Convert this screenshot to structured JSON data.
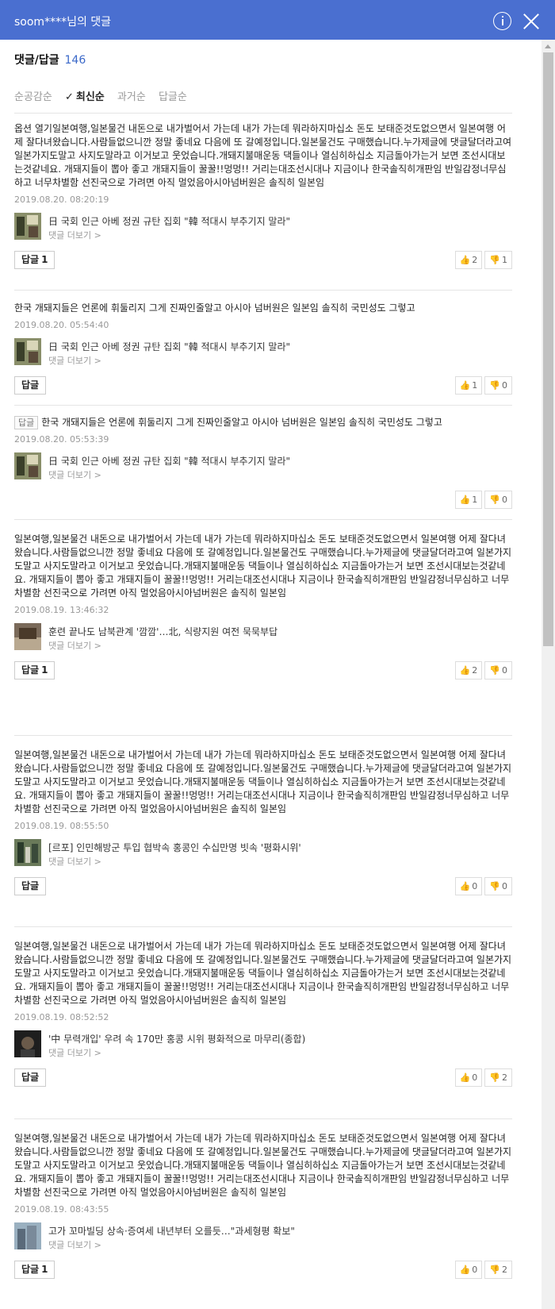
{
  "window": {
    "title": "soom****님의 댓글"
  },
  "header": {
    "label": "댓글/답글",
    "count": "146"
  },
  "sort": {
    "tabs": [
      {
        "label": "순공감순",
        "active": false
      },
      {
        "label": "최신순",
        "active": true
      },
      {
        "label": "과거순",
        "active": false
      },
      {
        "label": "답글순",
        "active": false
      }
    ]
  },
  "comments": [
    {
      "is_reply": false,
      "reply_tag": "",
      "text": "옵션 열기일본여행,일본물건 내돈으로 내가벌어서 가는데 내가 가는데 뭐라하지마십소 돈도 보태준것도없으면서 일본여행 어제 잘다녀왔습니다.사람들없으니깐 정말 좋네요 다음에 또 갈예정입니다.일본물건도 구매했습니다.누가제글에 댓글달더라고여 일본가지도말고 사지도말라고 이거보고 웃었습니다.개돼지불매운동 댁들이나 열심히하십소 지금돌아가는거 보면 조선시대보는것같네요. 개돼지들이 뽑아 좋고 개돼지들이 꿀꿀!!멍멍!! 거리는대조선시대나 지금이나 한국솔직히개판임 반일감정너무심하고 너무차별함 선진국으로 가려면 아직 멀었음아시아넘버원은 솔직히 일본임",
      "date": "2019.08.20. 08:20:19",
      "article_title": "日 국회 인근 아베 정권 규탄 집회 \"韓 적대시 부추기지 말라\"",
      "more": "댓글 더보기 >",
      "reply_label": "답글",
      "reply_count": "1",
      "likes": "2",
      "dislikes": "1"
    },
    {
      "is_reply": false,
      "reply_tag": "",
      "text": "한국 개돼지들은 언론에 휘둘리지 그게 진짜인줄알고 아시아 넘버원은 일본임 솔직히 국민성도 그렇고",
      "date": "2019.08.20. 05:54:40",
      "article_title": "日 국회 인근 아베 정권 규탄 집회 \"韓 적대시 부추기지 말라\"",
      "more": "댓글 더보기 >",
      "reply_label": "답글",
      "reply_count": "",
      "likes": "1",
      "dislikes": "0"
    },
    {
      "is_reply": true,
      "reply_tag": "답글",
      "text": "한국 개돼지들은 언론에 휘둘리지 그게 진짜인줄알고 아시아 넘버원은 일본임 솔직히 국민성도 그렇고",
      "date": "2019.08.20. 05:53:39",
      "article_title": "日 국회 인근 아베 정권 규탄 집회 \"韓 적대시 부추기지 말라\"",
      "more": "댓글 더보기 >",
      "reply_label": "",
      "reply_count": "",
      "likes": "1",
      "dislikes": "0"
    },
    {
      "is_reply": false,
      "reply_tag": "",
      "text": "일본여행,일본물건 내돈으로 내가벌어서 가는데 내가 가는데 뭐라하지마십소 돈도 보태준것도없으면서 일본여행 어제 잘다녀왔습니다.사람들없으니깐 정말 좋네요 다음에 또 갈예정입니다.일본물건도 구매했습니다.누가제글에 댓글달더라고여 일본가지도말고 사지도말라고 이거보고 웃었습니다.개돼지불매운동 댁들이나 열심히하십소 지금돌아가는거 보면 조선시대보는것같네요. 개돼지들이 뽑아 좋고 개돼지들이 꿀꿀!!멍멍!! 거리는대조선시대나 지금이나 한국솔직히개판임 반일감정너무심하고 너무차별함 선진국으로 가려면 아직 멀었음아시아넘버원은 솔직히 일본임",
      "date": "2019.08.19. 13:46:32",
      "article_title": "훈련 끝나도 남북관계 '깜깜'…北, 식량지원 여전 묵묵부답",
      "more": "댓글 더보기 >",
      "reply_label": "답글",
      "reply_count": "1",
      "likes": "2",
      "dislikes": "0"
    },
    {
      "is_reply": false,
      "reply_tag": "",
      "text": "일본여행,일본물건 내돈으로 내가벌어서 가는데 내가 가는데 뭐라하지마십소 돈도 보태준것도없으면서 일본여행 어제 잘다녀왔습니다.사람들없으니깐 정말 좋네요 다음에 또 갈예정입니다.일본물건도 구매했습니다.누가제글에 댓글달더라고여 일본가지도말고 사지도말라고 이거보고 웃었습니다.개돼지불매운동 댁들이나 열심히하십소 지금돌아가는거 보면 조선시대보는것같네요. 개돼지들이 뽑아 좋고 개돼지들이 꿀꿀!!멍멍!! 거리는대조선시대나 지금이나 한국솔직히개판임 반일감정너무심하고 너무차별함 선진국으로 가려면 아직 멀었음아시아넘버원은 솔직히 일본임",
      "date": "2019.08.19. 08:55:50",
      "article_title": "[르포] 인민해방군 투입 협박속 홍콩인 수십만명 빗속 '평화시위'",
      "more": "댓글 더보기 >",
      "reply_label": "답글",
      "reply_count": "",
      "likes": "0",
      "dislikes": "0"
    },
    {
      "is_reply": false,
      "reply_tag": "",
      "text": "일본여행,일본물건 내돈으로 내가벌어서 가는데 내가 가는데 뭐라하지마십소 돈도 보태준것도없으면서 일본여행 어제 잘다녀왔습니다.사람들없으니깐 정말 좋네요 다음에 또 갈예정입니다.일본물건도 구매했습니다.누가제글에 댓글달더라고여 일본가지도말고 사지도말라고 이거보고 웃었습니다.개돼지불매운동 댁들이나 열심히하십소 지금돌아가는거 보면 조선시대보는것같네요. 개돼지들이 뽑아 좋고 개돼지들이 꿀꿀!!멍멍!! 거리는대조선시대나 지금이나 한국솔직히개판임 반일감정너무심하고 너무차별함 선진국으로 가려면 아직 멀었음아시아넘버원은 솔직히 일본임",
      "date": "2019.08.19. 08:52:52",
      "article_title": "'中 무력개입' 우려 속 170만 홍콩 시위 평화적으로 마무리(종합)",
      "more": "댓글 더보기 >",
      "reply_label": "답글",
      "reply_count": "",
      "likes": "0",
      "dislikes": "2"
    },
    {
      "is_reply": false,
      "reply_tag": "",
      "text": "일본여행,일본물건 내돈으로 내가벌어서 가는데 내가 가는데 뭐라하지마십소 돈도 보태준것도없으면서 일본여행 어제 잘다녀왔습니다.사람들없으니깐 정말 좋네요 다음에 또 갈예정입니다.일본물건도 구매했습니다.누가제글에 댓글달더라고여 일본가지도말고 사지도말라고 이거보고 웃었습니다.개돼지불매운동 댁들이나 열심히하십소 지금돌아가는거 보면 조선시대보는것같네요. 개돼지들이 뽑아 좋고 개돼지들이 꿀꿀!!멍멍!! 거리는대조선시대나 지금이나 한국솔직히개판임 반일감정너무심하고 너무차별함 선진국으로 가려면 아직 멀었음아시아넘버원은 솔직히 일본임",
      "date": "2019.08.19. 08:43:55",
      "article_title": "고가 꼬마빌딩 상속·증여세 내년부터 오를듯…\"과세형평 확보\"",
      "more": "댓글 더보기 >",
      "reply_label": "답글",
      "reply_count": "1",
      "likes": "0",
      "dislikes": "2"
    }
  ]
}
